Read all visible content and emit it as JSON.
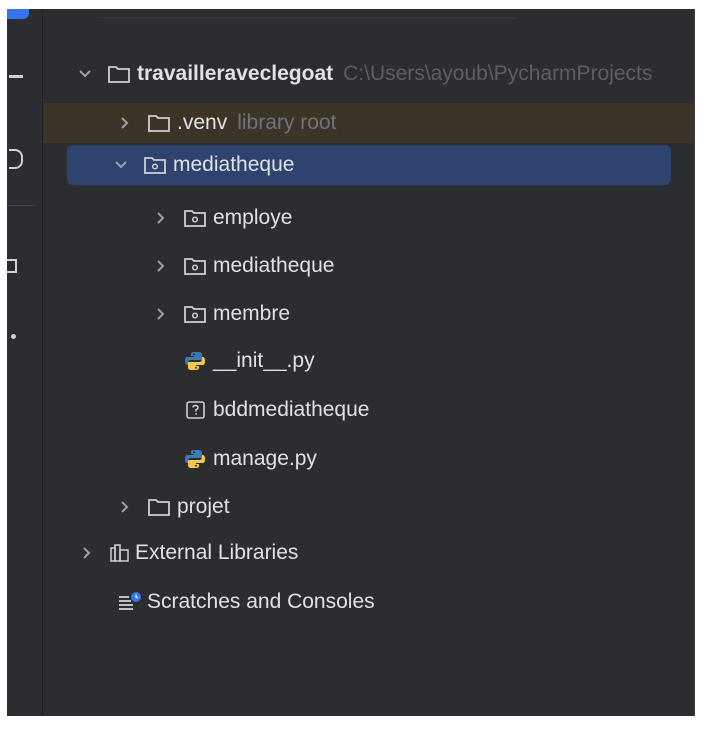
{
  "project_tree": {
    "root": {
      "name": "travailleraveclegoat",
      "path": "C:\\Users\\ayoub\\PycharmProjects"
    },
    "venv": {
      "name": ".venv",
      "hint": "library root"
    },
    "package": {
      "name": "mediatheque"
    },
    "children": {
      "employe": "employe",
      "mediatheque": "mediatheque",
      "membre": "membre",
      "init": "__init__.py",
      "bdd": "bddmediatheque",
      "manage": "manage.py"
    },
    "projet": "projet",
    "external_libraries": "External Libraries",
    "scratches": "Scratches and Consoles"
  },
  "colors": {
    "panel_bg": "#2b2d30",
    "selection": "#2e436e",
    "excluded_highlight": "#3c3426",
    "text": "#dfe1e5",
    "hint": "#6f737a",
    "python_blue": "#3d7ab8",
    "python_yellow": "#f2c94c"
  }
}
